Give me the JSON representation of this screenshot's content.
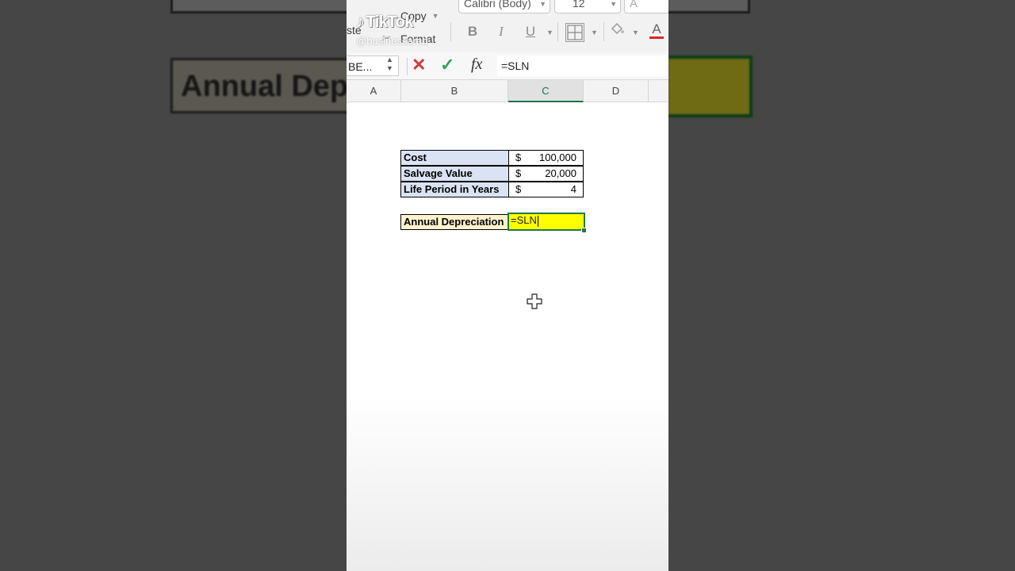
{
  "ribbon": {
    "paste_partial": "ste",
    "copy_label": "Copy",
    "format_label": "Format",
    "font_name": "Calibri (Body)",
    "font_size": "12",
    "bold": "B",
    "italic": "I",
    "underline": "U",
    "font_color_letter": "A",
    "grow_font": "A",
    "font_color_hex": "#d9272e"
  },
  "overlay": {
    "app_name": "TikTok",
    "handle": "@businessarab"
  },
  "formula_bar": {
    "name_box": "BE...",
    "fx_label": "fx",
    "formula": "=SLN"
  },
  "columns": [
    "A",
    "B",
    "C",
    "D"
  ],
  "selected_column": "C",
  "inputs_table": [
    {
      "label": "Cost",
      "currency": "$",
      "value": "100,000"
    },
    {
      "label": "Salvage Value",
      "currency": "$",
      "value": "20,000"
    },
    {
      "label": "Life Period in Years",
      "currency": "$",
      "value": "4"
    }
  ],
  "result": {
    "label": "Annual Depreciation",
    "editing_text": "=SLN"
  },
  "background_zoom": {
    "annual_text": "Annual Dep"
  },
  "colors": {
    "label_fill": "#dae3f3",
    "result_label_fill": "#fff2cc",
    "active_cell_fill": "#ffff00",
    "selection_green": "#1f7a45"
  }
}
